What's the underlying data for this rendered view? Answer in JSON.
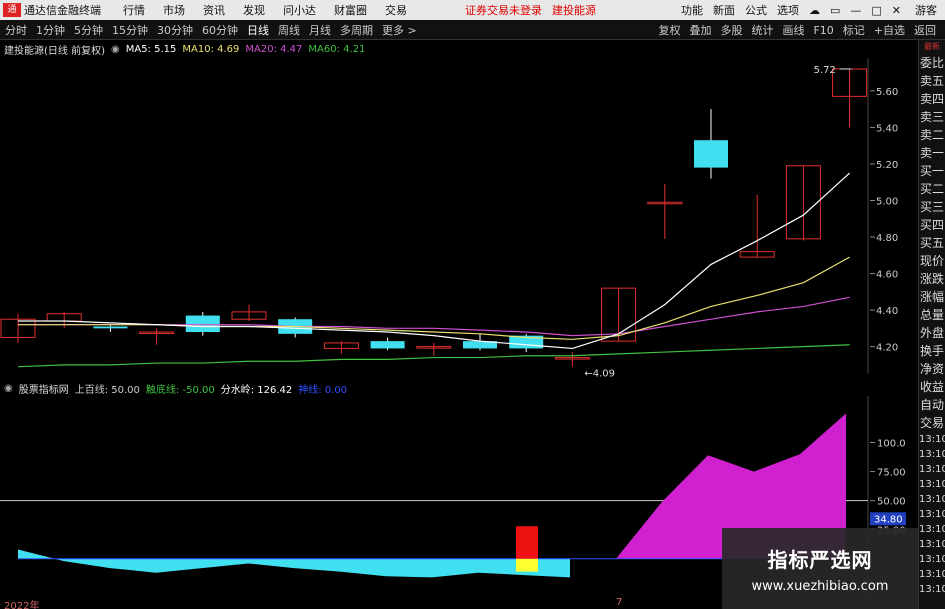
{
  "menubar": {
    "app_title": "通达信金融终端",
    "items": [
      "行情",
      "市场",
      "资讯",
      "发现",
      "问小达",
      "财富圈",
      "交易"
    ],
    "alerts": [
      "证券交易未登录",
      "建投能源"
    ],
    "right_items": [
      "功能",
      "新面",
      "公式",
      "选项"
    ],
    "user": "游客",
    "logo_icon": "tdx-logo-icon"
  },
  "periodbar": {
    "periods": [
      "分时",
      "1分钟",
      "5分钟",
      "15分钟",
      "30分钟",
      "60分钟",
      "日线",
      "周线",
      "月线",
      "多周期",
      "更多 >"
    ],
    "active": "日线",
    "right_items": [
      "复权",
      "叠加",
      "多股",
      "统计",
      "画线",
      "F10",
      "标记",
      "+自选",
      "返回"
    ]
  },
  "infobar": {
    "title": "建投能源(日线 前复权)",
    "ma5": "MA5: 5.15",
    "ma10": "MA10: 4.69",
    "ma20": "MA20: 4.47",
    "ma60": "MA60: 4.21",
    "colors": {
      "ma5": "#ffffff",
      "ma10": "#e8e070",
      "ma20": "#d050d0",
      "ma60": "#40c040"
    }
  },
  "chart1": {
    "yticks": [
      "5.60",
      "5.40",
      "5.20",
      "5.00",
      "4.80",
      "4.60",
      "4.40",
      "4.20"
    ],
    "yvalues": [
      5.6,
      5.4,
      5.2,
      5.0,
      4.8,
      4.6,
      4.4,
      4.2
    ],
    "high_label": "5.72",
    "low_label": "4.09",
    "candles": [
      [
        4.25,
        4.35,
        4.38,
        4.22
      ],
      [
        4.34,
        4.38,
        4.39,
        4.3
      ],
      [
        4.31,
        4.3,
        4.32,
        4.28
      ],
      [
        4.28,
        4.28,
        4.3,
        4.21
      ],
      [
        4.37,
        4.28,
        4.39,
        4.26
      ],
      [
        4.35,
        4.39,
        4.43,
        4.34
      ],
      [
        4.35,
        4.27,
        4.36,
        4.25
      ],
      [
        4.19,
        4.22,
        4.23,
        4.16
      ],
      [
        4.23,
        4.19,
        4.25,
        4.18
      ],
      [
        4.2,
        4.2,
        4.22,
        4.15
      ],
      [
        4.23,
        4.19,
        4.27,
        4.18
      ],
      [
        4.26,
        4.19,
        4.27,
        4.17
      ],
      [
        4.14,
        4.14,
        4.17,
        4.09
      ],
      [
        4.23,
        4.52,
        4.52,
        4.23
      ],
      [
        4.99,
        4.99,
        5.09,
        4.79
      ],
      [
        5.33,
        5.18,
        5.5,
        5.12
      ],
      [
        4.69,
        4.72,
        5.03,
        4.69
      ],
      [
        4.79,
        5.19,
        5.19,
        4.78
      ],
      [
        5.57,
        5.72,
        5.72,
        5.4
      ]
    ],
    "ma5": [
      4.34,
      4.34,
      4.33,
      4.32,
      4.31,
      4.31,
      4.3,
      4.29,
      4.28,
      4.26,
      4.23,
      4.21,
      4.19,
      4.27,
      4.43,
      4.65,
      4.78,
      4.92,
      5.15
    ],
    "ma10": [
      4.32,
      4.32,
      4.32,
      4.32,
      4.31,
      4.31,
      4.31,
      4.3,
      4.29,
      4.28,
      4.27,
      4.25,
      4.24,
      4.26,
      4.33,
      4.42,
      4.48,
      4.55,
      4.69
    ],
    "ma20": [
      4.32,
      4.32,
      4.32,
      4.32,
      4.32,
      4.32,
      4.31,
      4.31,
      4.3,
      4.3,
      4.29,
      4.28,
      4.26,
      4.27,
      4.31,
      4.35,
      4.39,
      4.42,
      4.47
    ],
    "ma60": [
      4.09,
      4.1,
      4.1,
      4.11,
      4.11,
      4.12,
      4.12,
      4.13,
      4.13,
      4.14,
      4.14,
      4.15,
      4.15,
      4.16,
      4.17,
      4.18,
      4.19,
      4.2,
      4.21
    ]
  },
  "chart2": {
    "title": "股票指标网",
    "items": [
      {
        "text": "上百线: 50.00",
        "color": "#cccccc"
      },
      {
        "text": "触底线: -50.00",
        "color": "#40c040"
      },
      {
        "text": "分水岭: 126.42",
        "color": "#ffffff"
      },
      {
        "text": "神线: 0.00",
        "color": "#3050ff"
      }
    ],
    "yticks": [
      "100.0",
      "75.00",
      "50.00",
      "25.00"
    ],
    "yvalues": [
      100,
      75,
      50,
      25
    ],
    "current_value": "34.80",
    "cyan": [
      {
        "x": 0,
        "y": 8
      },
      {
        "x": 46,
        "y": -2
      },
      {
        "x": 92,
        "y": -8
      },
      {
        "x": 138,
        "y": -12
      },
      {
        "x": 184,
        "y": -8
      },
      {
        "x": 230,
        "y": -4
      },
      {
        "x": 276,
        "y": -8
      },
      {
        "x": 322,
        "y": -11
      },
      {
        "x": 368,
        "y": -15
      },
      {
        "x": 414,
        "y": -16
      },
      {
        "x": 460,
        "y": -12
      },
      {
        "x": 506,
        "y": -14
      },
      {
        "x": 552,
        "y": -16
      }
    ],
    "magenta": [
      {
        "x": 552,
        "y": -12
      },
      {
        "x": 598,
        "y": 0
      },
      {
        "x": 644,
        "y": 49
      },
      {
        "x": 690,
        "y": 89
      },
      {
        "x": 736,
        "y": 75
      },
      {
        "x": 782,
        "y": 90
      },
      {
        "x": 828,
        "y": 125
      }
    ],
    "bar": {
      "red": 28,
      "yellow": -11
    }
  },
  "timeaxis": {
    "start_label": "2022年",
    "mid_label": "7"
  },
  "sidebar": {
    "top_label": "委比",
    "items": [
      "委比",
      "卖五",
      "卖四",
      "卖三",
      "卖二",
      "卖一",
      "买一",
      "买二",
      "买三",
      "买四",
      "买五",
      "现价",
      "涨跌",
      "涨幅",
      "总量",
      "外盘",
      "换手",
      "净资",
      "收益",
      "自动",
      "交易",
      "13:10",
      "13:10",
      "13:10",
      "13:10",
      "13:10",
      "13:10",
      "13:10",
      "13:10",
      "13:10",
      "13:10",
      "13:10"
    ],
    "alert": {
      "text": "最新",
      "color": "#dd3333"
    }
  },
  "watermark": {
    "title": "指标严选网",
    "url": "www.xuezhibiao.com"
  }
}
